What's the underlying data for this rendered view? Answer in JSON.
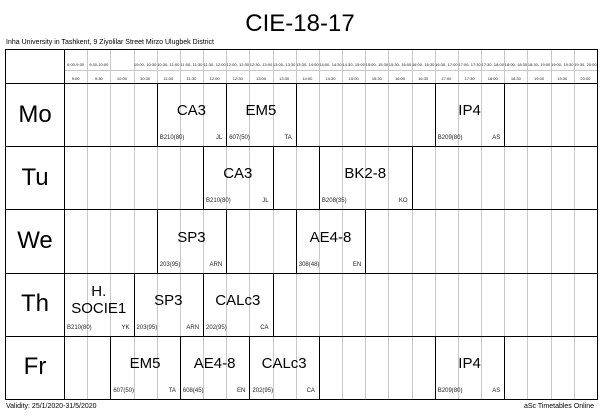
{
  "title": "CIE-18-17",
  "subtitle": "Inha University in Tashkent, 9 Ziyolilar Street Mirzo Ulugbek District",
  "footer": {
    "validity": "Validity: 25/1/2020-31/5/2020",
    "credit": "aSc Timetables Online"
  },
  "time_slots": [
    [
      "6:00-9:30",
      "9:00"
    ],
    [
      "9:30-10:00",
      "9:30"
    ],
    [
      "",
      "10:00"
    ],
    [
      "10:00- 10:30",
      "10:30"
    ],
    [
      "10:30- 11:00",
      "11:00"
    ],
    [
      "11:00- 11:30",
      "11:30"
    ],
    [
      "11:30- 12:00",
      "12:00"
    ],
    [
      "12:00- 12:30",
      "12:30"
    ],
    [
      "12:30- 13:00",
      "13:00"
    ],
    [
      "13:00- 13:30",
      "13:30"
    ],
    [
      "13:30- 14:00",
      "14:00"
    ],
    [
      "14:00- 14:30",
      "14:30"
    ],
    [
      "14:30- 15:00",
      "15:00"
    ],
    [
      "15:00- 15:30",
      "15:30"
    ],
    [
      "15:30- 16:00",
      "16:00"
    ],
    [
      "16:00- 16:30",
      "16:30"
    ],
    [
      "16:30- 17:00",
      "17:00"
    ],
    [
      "17:00- 17:30",
      "17:30"
    ],
    [
      "17:30- 18:00",
      "18:00"
    ],
    [
      "18:00- 18:30",
      "18:30"
    ],
    [
      "18:30- 19:00",
      "19:00"
    ],
    [
      "19:00- 19:30",
      "19:30"
    ],
    [
      "19:30- 20:00",
      "20:00"
    ]
  ],
  "days": [
    {
      "name": "Mo",
      "lessons": [
        {
          "subject": "CA3",
          "room": "B210(80)",
          "teacher": "JL",
          "start": 4,
          "span": 3
        },
        {
          "subject": "EM5",
          "room": "607(50)",
          "teacher": "TA",
          "start": 7,
          "span": 3
        },
        {
          "subject": "IP4",
          "room": "B209(80)",
          "teacher": "AS",
          "start": 16,
          "span": 3
        }
      ]
    },
    {
      "name": "Tu",
      "lessons": [
        {
          "subject": "CA3",
          "room": "B210(80)",
          "teacher": "JL",
          "start": 6,
          "span": 3
        },
        {
          "subject": "BK2-8",
          "room": "B208(35)",
          "teacher": "KO",
          "start": 11,
          "span": 4
        }
      ]
    },
    {
      "name": "We",
      "lessons": [
        {
          "subject": "SP3",
          "room": "203(95)",
          "teacher": "ARN",
          "start": 4,
          "span": 3
        },
        {
          "subject": "AE4-8",
          "room": "308(48)",
          "teacher": "EN",
          "start": 10,
          "span": 3
        }
      ]
    },
    {
      "name": "Th",
      "lessons": [
        {
          "subject": "H.\nSOCIE1",
          "room": "B210(80)",
          "teacher": "YK",
          "start": 0,
          "span": 3
        },
        {
          "subject": "SP3",
          "room": "203(95)",
          "teacher": "ARN",
          "start": 3,
          "span": 3
        },
        {
          "subject": "CALc3",
          "room": "202(95)",
          "teacher": "CA",
          "start": 6,
          "span": 3
        }
      ]
    },
    {
      "name": "Fr",
      "lessons": [
        {
          "subject": "EM5",
          "room": "607(50)",
          "teacher": "TA",
          "start": 2,
          "span": 3
        },
        {
          "subject": "AE4-8",
          "room": "608(45)",
          "teacher": "EN",
          "start": 5,
          "span": 3
        },
        {
          "subject": "CALc3",
          "room": "202(95)",
          "teacher": "CA",
          "start": 8,
          "span": 3
        },
        {
          "subject": "IP4",
          "room": "B209(80)",
          "teacher": "AS",
          "start": 16,
          "span": 3
        }
      ]
    }
  ]
}
